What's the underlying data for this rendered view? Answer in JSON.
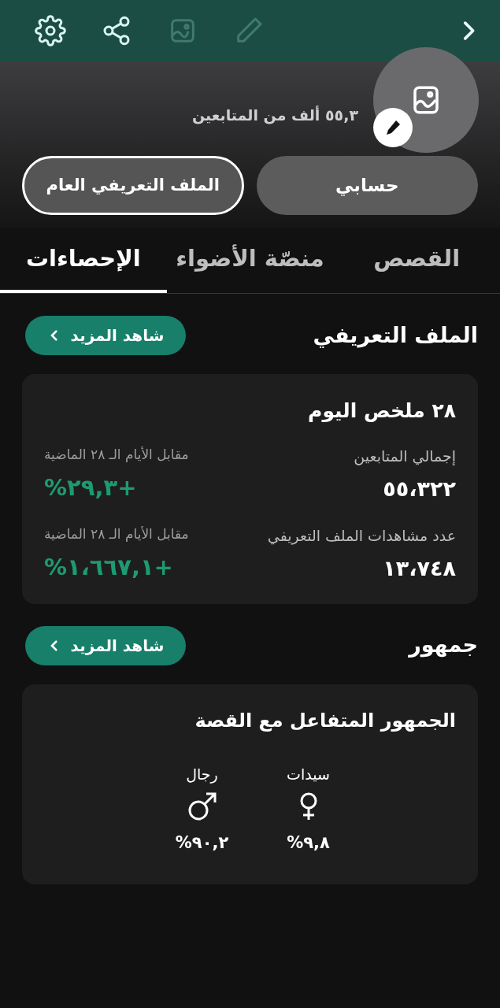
{
  "toolbar": {
    "actions": [
      {
        "kind": "settings",
        "disabled": false
      },
      {
        "kind": "share",
        "disabled": false
      },
      {
        "kind": "image",
        "disabled": true
      },
      {
        "kind": "edit",
        "disabled": true
      }
    ],
    "forward": {
      "kind": "chevron"
    }
  },
  "profile": {
    "followers": "٥٥,٣ ألف من المتابعين",
    "buttons": [
      {
        "label": "حسابي",
        "outlined": false
      },
      {
        "label": "الملف التعريفي العام",
        "outlined": true
      }
    ]
  },
  "tabs": [
    {
      "label": "القصص",
      "selected": false
    },
    {
      "label": "منصّة الأضواء",
      "selected": false
    },
    {
      "label": "الإحصاءات",
      "selected": true
    }
  ],
  "sections": [
    {
      "title": "الملف التعريفي",
      "more": "شاهد المزيد",
      "card": {
        "kind": "summary",
        "title": "٢٨ ملخص اليوم",
        "metrics": [
          {
            "label": "إجمالي المتابعين",
            "value": "٥٥،٣٢٢",
            "compare_label": "مقابل الأيام الـ ٢٨ الماضية",
            "change": "%٢٩,٣+"
          },
          {
            "label": "عدد مشاهدات الملف التعريفي",
            "value": "١٣،٧٤٨",
            "compare_label": "مقابل الأيام الـ ٢٨ الماضية",
            "change": "%١،٦٦٧,١+"
          }
        ]
      }
    },
    {
      "title": "جمهور",
      "more": "شاهد المزيد",
      "card": {
        "kind": "gender",
        "title": "الجمهور المتفاعل مع القصة",
        "groups": [
          {
            "kind": "female",
            "label": "سيدات",
            "share": "%٩,٨"
          },
          {
            "kind": "male",
            "label": "رجال",
            "share": "%٩٠,٢"
          }
        ]
      }
    }
  ]
}
